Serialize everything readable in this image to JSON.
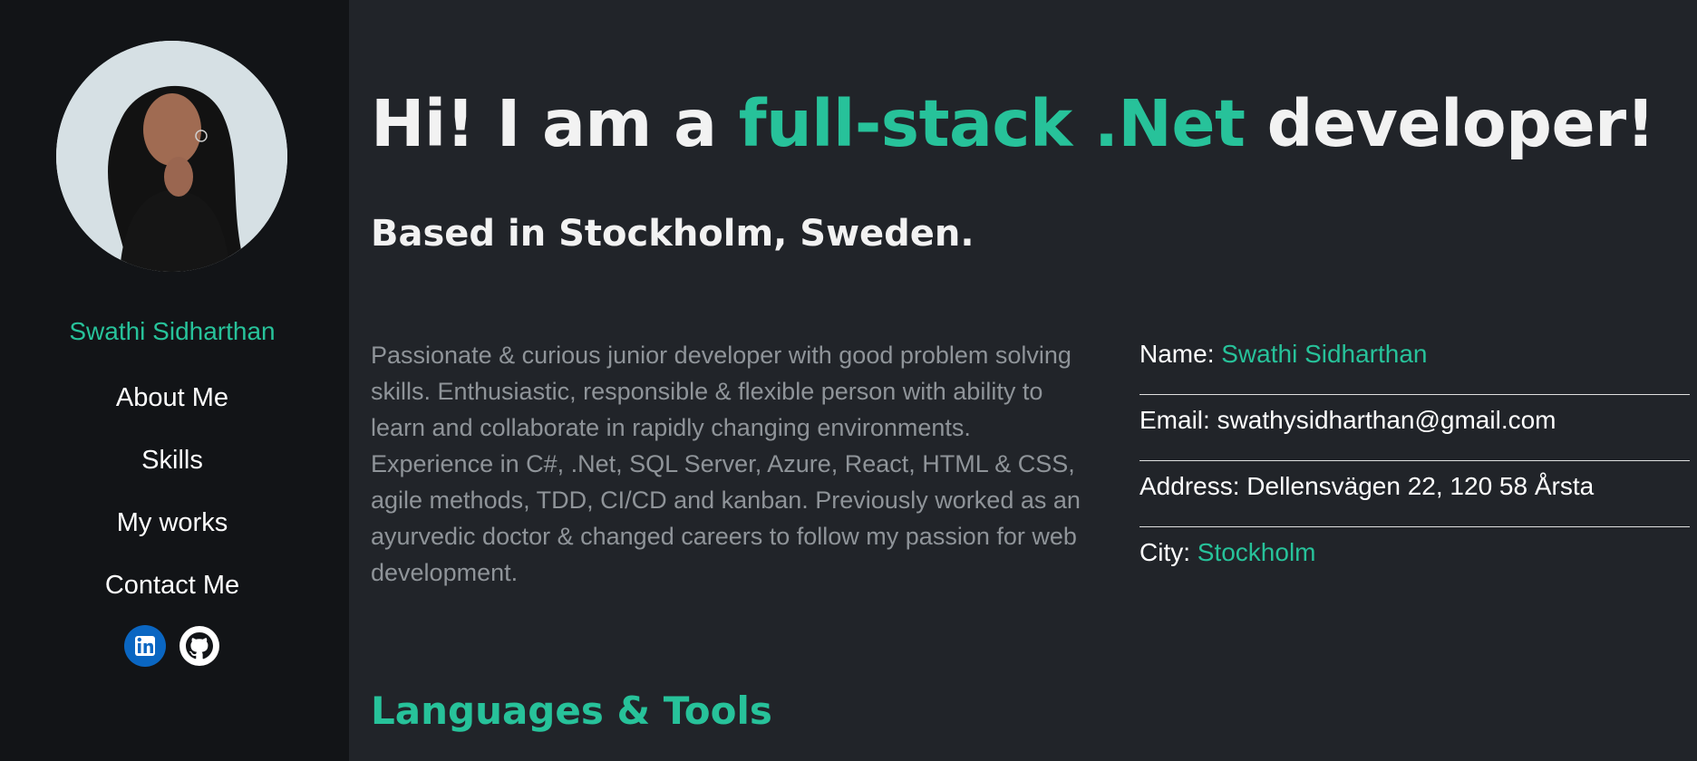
{
  "colors": {
    "accent": "#27c29a",
    "sidebar_bg": "#121417",
    "main_bg": "#212429",
    "muted_text": "#8f9499"
  },
  "sidebar": {
    "brand_name": "Swathi Sidharthan",
    "nav": [
      {
        "label": "About Me"
      },
      {
        "label": "Skills"
      },
      {
        "label": "My works"
      },
      {
        "label": "Contact Me"
      }
    ],
    "social": [
      {
        "icon": "linkedin-icon"
      },
      {
        "icon": "github-icon"
      }
    ]
  },
  "main": {
    "headline": {
      "prefix": "Hi! I am a ",
      "highlight": "full-stack .Net",
      "suffix": " developer!"
    },
    "subheadline": "Based in Stockholm, Sweden.",
    "bio": "Passionate & curious junior developer with good problem solving skills. Enthusiastic, responsible & flexible person with ability to learn and collaborate in rapidly changing environments. Experience in C#, .Net, SQL Server, Azure, React, HTML & CSS, agile methods, TDD, CI/CD and kanban. Previously worked as an ayurvedic doctor & changed careers to follow my passion for web development.",
    "info": {
      "name": {
        "label": "Name: ",
        "value": "Swathi Sidharthan"
      },
      "email": {
        "label": "Email: ",
        "value": "swathysidharthan@gmail.com"
      },
      "address": {
        "label": "Address: ",
        "value": "Dellensvägen 22, 120 58 Årsta"
      },
      "city": {
        "label": "City: ",
        "value": "Stockholm"
      }
    },
    "section_title": "Languages & Tools"
  }
}
